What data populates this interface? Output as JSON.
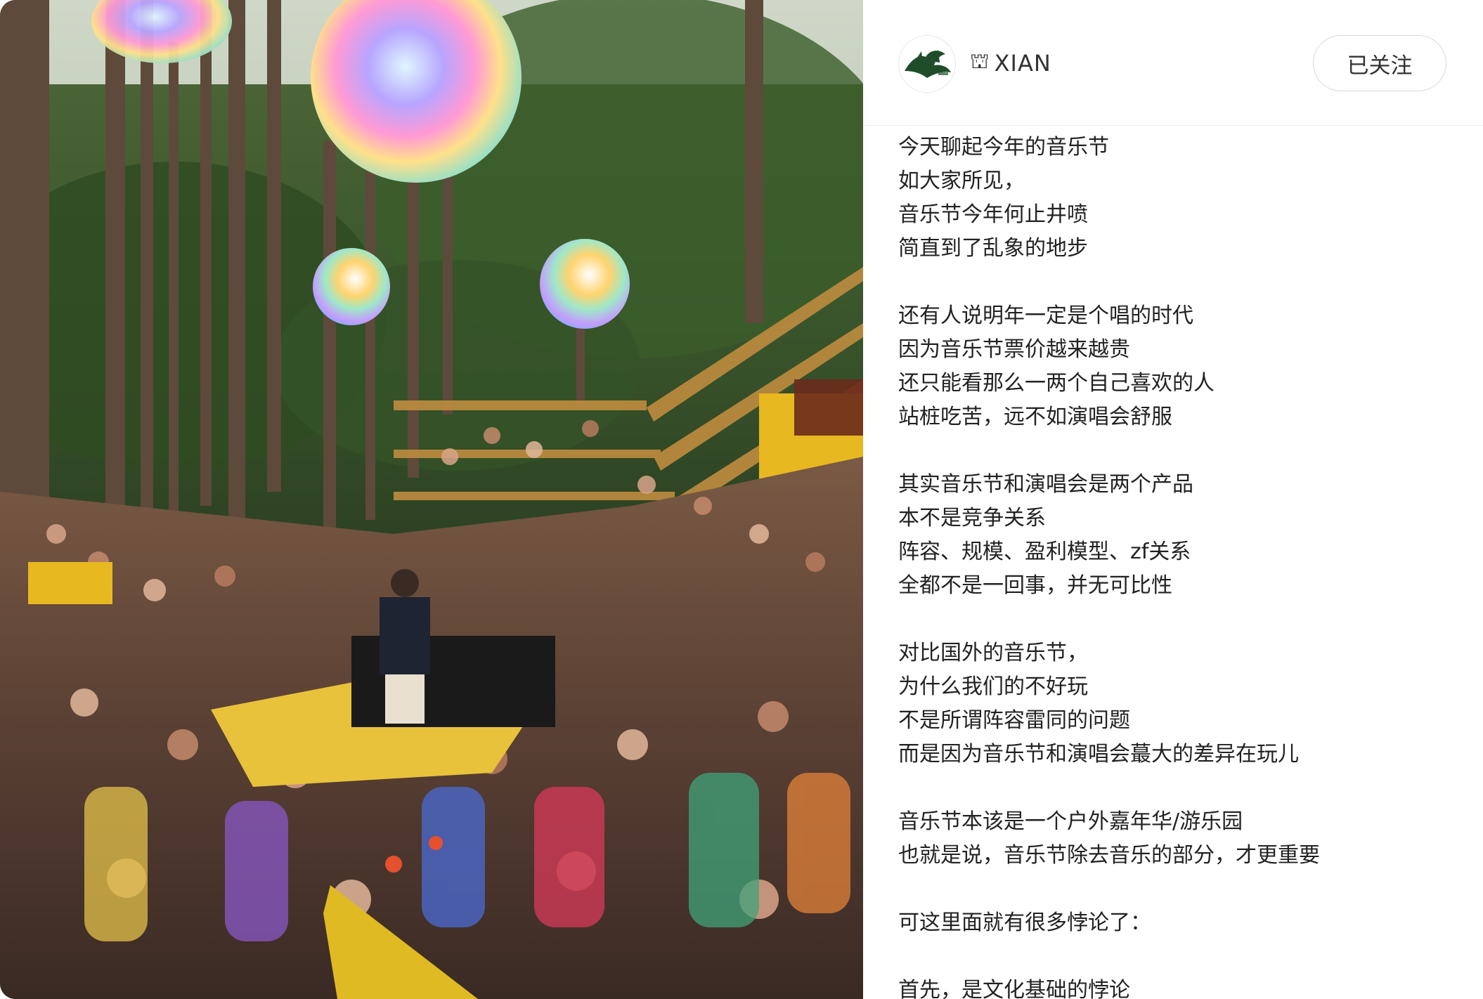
{
  "author": {
    "name": "XIAN",
    "name_symbol": "⛫",
    "avatar_label": "XIAN"
  },
  "follow_button": {
    "label": "已关注"
  },
  "content": {
    "paragraphs": [
      [
        "今天聊起今年的音乐节",
        "如大家所见，",
        "音乐节今年何止井喷",
        "简直到了乱象的地步"
      ],
      [
        "还有人说明年一定是个唱的时代",
        "因为音乐节票价越来越贵",
        "还只能看那么一两个自己喜欢的人",
        "站桩吃苦，远不如演唱会舒服"
      ],
      [
        "其实音乐节和演唱会是两个产品",
        "本不是竞争关系",
        "阵容、规模、盈利模型、zf关系",
        "全都不是一回事，并无可比性"
      ],
      [
        "对比国外的音乐节，",
        "为什么我们的不好玩",
        "不是所谓阵容雷同的问题",
        "而是因为音乐节和演唱会蕞大的差异在玩儿"
      ],
      [
        "音乐节本该是一个户外嘉年华/游乐园",
        "也就是说，音乐节除去音乐的部分，才更重要"
      ],
      [
        "可这里面就有很多悖论了："
      ],
      [
        "首先，是文化基础的悖论"
      ]
    ]
  },
  "photo": {
    "description_icon": "festival-photo"
  },
  "colors": {
    "text": "#222222",
    "border": "#d9d9d9",
    "stage_yellow": "#e8b820"
  }
}
